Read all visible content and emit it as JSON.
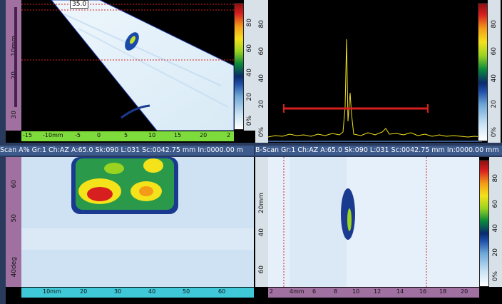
{
  "top_left": {
    "depth_ruler": {
      "ticks": [
        "10mm",
        "20",
        "30"
      ]
    },
    "index_ruler": {
      "ticks": [
        "-15",
        "-10mm",
        "-5",
        "0",
        "5",
        "10",
        "15",
        "20",
        "2"
      ]
    },
    "top_marker": "35.0",
    "colorbar": {
      "labels": [
        "0%",
        "20",
        "40",
        "60",
        "80"
      ]
    }
  },
  "top_right": {
    "y_ticks": [
      "0%",
      "20",
      "40",
      "60",
      "80"
    ],
    "colorbar": {
      "labels": [
        "0%",
        "20",
        "40",
        "60",
        "80"
      ]
    }
  },
  "status": {
    "left": "Scan A% Gr:1 Ch:AZ A:65.0 Sk:090 L:031 Sc:0042.75 mm In:0000.00 m",
    "right": "B-Scan Gr:1 Ch:AZ A:65.0 Sk:090 L:031 Sc:0042.75 mm In:0000.00 mm"
  },
  "bottom_left": {
    "left_ruler": {
      "ticks": [
        "40deg",
        "50",
        "60"
      ]
    },
    "bottom_ruler": {
      "ticks": [
        "10mm",
        "20",
        "30",
        "40",
        "50",
        "60"
      ]
    }
  },
  "bottom_right": {
    "left_ruler": {
      "ticks": [
        "20mm",
        "40",
        "60"
      ]
    },
    "bottom_ruler": {
      "ticks": [
        "2",
        "4mm",
        "6",
        "8",
        "10",
        "12",
        "14",
        "16",
        "18",
        "20"
      ]
    },
    "colorbar": {
      "labels": [
        "0%",
        "20",
        "40",
        "60",
        "80"
      ]
    }
  },
  "colors": {
    "background": "#2a3a5c",
    "ruler_purple": "#a070a0",
    "ruler_green": "#7ddc3c",
    "ruler_cyan": "#3ec8d8",
    "cursor_red": "#d62020"
  }
}
